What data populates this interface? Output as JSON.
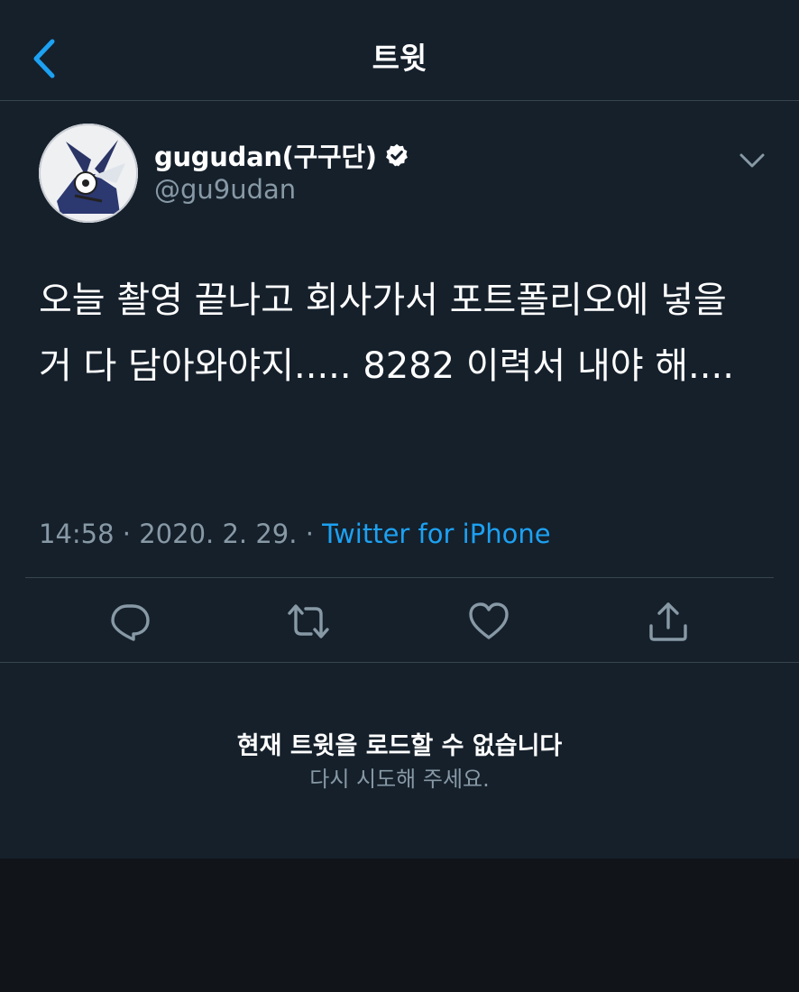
{
  "header": {
    "title": "트윗",
    "back_icon": "chevron-left-icon"
  },
  "tweet": {
    "display_name": "gugudan(구구단)",
    "handle": "@gu9udan",
    "verified_icon": "verified-badge-icon",
    "text": "오늘 촬영 끝나고 회사가서 포트폴리오에 넣을 거 다 담아와야지..... 8282 이력서 내야 해....",
    "timestamp": "14:58 · 2020. 2. 29. · ",
    "source": "Twitter for iPhone"
  },
  "actions": [
    {
      "icon": "reply-icon"
    },
    {
      "icon": "retweet-icon"
    },
    {
      "icon": "like-icon"
    },
    {
      "icon": "share-icon"
    }
  ],
  "error": {
    "title": "현재 트윗을 로드할 수 없습니다",
    "subtitle": "다시 시도해 주세요."
  },
  "colors": {
    "background": "#15202b",
    "accent": "#1da1f2",
    "secondary_text": "#8899a6",
    "divider": "#38444d"
  }
}
